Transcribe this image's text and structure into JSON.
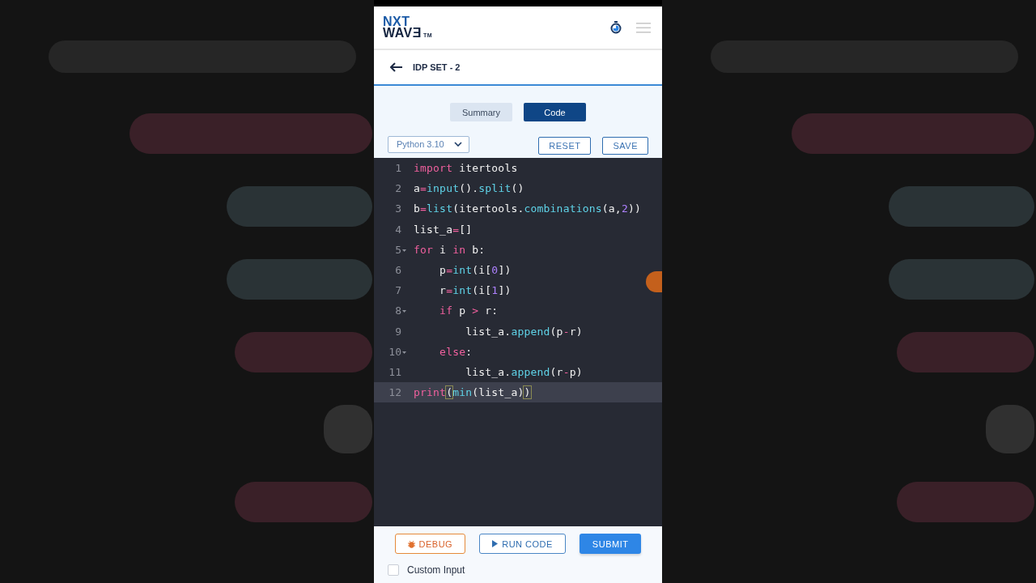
{
  "logo": {
    "line1": "NXT",
    "line2": "WAVƎ",
    "mark": "TM"
  },
  "title": "IDP SET - 2",
  "tabs": [
    {
      "label": "Summary",
      "selected": false
    },
    {
      "label": "Code",
      "selected": true
    }
  ],
  "language": {
    "value": "Python 3.10"
  },
  "actions": [
    "RESET",
    "SAVE"
  ],
  "editor": {
    "lines": [
      {
        "number": "1",
        "foldable": false,
        "active": false,
        "tokens": [
          {
            "text": "import",
            "kind": "kw"
          },
          {
            "text": " itertools",
            "kind": "plain"
          }
        ]
      },
      {
        "number": "2",
        "foldable": false,
        "active": false,
        "tokens": [
          {
            "text": "a",
            "kind": "plain"
          },
          {
            "text": "=",
            "kind": "op"
          },
          {
            "text": "input",
            "kind": "fn"
          },
          {
            "text": "().",
            "kind": "plain"
          },
          {
            "text": "split",
            "kind": "fn"
          },
          {
            "text": "()",
            "kind": "plain"
          }
        ]
      },
      {
        "number": "3",
        "foldable": false,
        "active": false,
        "tokens": [
          {
            "text": "b",
            "kind": "plain"
          },
          {
            "text": "=",
            "kind": "op"
          },
          {
            "text": "list",
            "kind": "fn"
          },
          {
            "text": "(itertools.",
            "kind": "plain"
          },
          {
            "text": "combinations",
            "kind": "fn"
          },
          {
            "text": "(a,",
            "kind": "plain"
          },
          {
            "text": "2",
            "kind": "num"
          },
          {
            "text": "))",
            "kind": "plain"
          }
        ]
      },
      {
        "number": "4",
        "foldable": false,
        "active": false,
        "tokens": [
          {
            "text": "list_a",
            "kind": "plain"
          },
          {
            "text": "=",
            "kind": "op"
          },
          {
            "text": "[]",
            "kind": "plain"
          }
        ]
      },
      {
        "number": "5",
        "foldable": true,
        "active": false,
        "tokens": [
          {
            "text": "for",
            "kind": "kw"
          },
          {
            "text": " i ",
            "kind": "plain"
          },
          {
            "text": "in",
            "kind": "kw"
          },
          {
            "text": " b:",
            "kind": "plain"
          }
        ]
      },
      {
        "number": "6",
        "foldable": false,
        "active": false,
        "tokens": [
          {
            "text": "    p",
            "kind": "plain"
          },
          {
            "text": "=",
            "kind": "op"
          },
          {
            "text": "int",
            "kind": "fn"
          },
          {
            "text": "(i[",
            "kind": "plain"
          },
          {
            "text": "0",
            "kind": "num"
          },
          {
            "text": "])",
            "kind": "plain"
          }
        ]
      },
      {
        "number": "7",
        "foldable": false,
        "active": false,
        "tokens": [
          {
            "text": "    r",
            "kind": "plain"
          },
          {
            "text": "=",
            "kind": "op"
          },
          {
            "text": "int",
            "kind": "fn"
          },
          {
            "text": "(i[",
            "kind": "plain"
          },
          {
            "text": "1",
            "kind": "num"
          },
          {
            "text": "])",
            "kind": "plain"
          }
        ]
      },
      {
        "number": "8",
        "foldable": true,
        "active": false,
        "tokens": [
          {
            "text": "    if",
            "kind": "kw"
          },
          {
            "text": " p ",
            "kind": "plain"
          },
          {
            "text": ">",
            "kind": "op"
          },
          {
            "text": " r:",
            "kind": "plain"
          }
        ]
      },
      {
        "number": "9",
        "foldable": false,
        "active": false,
        "tokens": [
          {
            "text": "        list_a.",
            "kind": "plain"
          },
          {
            "text": "append",
            "kind": "fn"
          },
          {
            "text": "(p",
            "kind": "plain"
          },
          {
            "text": "-",
            "kind": "op"
          },
          {
            "text": "r)",
            "kind": "plain"
          }
        ]
      },
      {
        "number": "10",
        "foldable": true,
        "active": false,
        "tokens": [
          {
            "text": "    else",
            "kind": "kw"
          },
          {
            "text": ":",
            "kind": "plain"
          }
        ]
      },
      {
        "number": "11",
        "foldable": false,
        "active": false,
        "tokens": [
          {
            "text": "        list_a.",
            "kind": "plain"
          },
          {
            "text": "append",
            "kind": "fn"
          },
          {
            "text": "(r",
            "kind": "plain"
          },
          {
            "text": "-",
            "kind": "op"
          },
          {
            "text": "p)",
            "kind": "plain"
          }
        ]
      },
      {
        "number": "12",
        "foldable": false,
        "active": true,
        "tokens": [
          {
            "text": "print",
            "kind": "kw"
          },
          {
            "text": "(",
            "kind": "bracket"
          },
          {
            "text": "min",
            "kind": "fn"
          },
          {
            "text": "(list_a)",
            "kind": "plain"
          },
          {
            "text": ")",
            "kind": "bracket"
          }
        ]
      }
    ]
  },
  "buttons": [
    {
      "label": "DEBUG",
      "kind": "debug"
    },
    {
      "label": "RUN CODE",
      "kind": "run"
    },
    {
      "label": "SUBMIT",
      "kind": "submit"
    }
  ],
  "custom_input": {
    "label": "Custom Input",
    "checked": false
  }
}
